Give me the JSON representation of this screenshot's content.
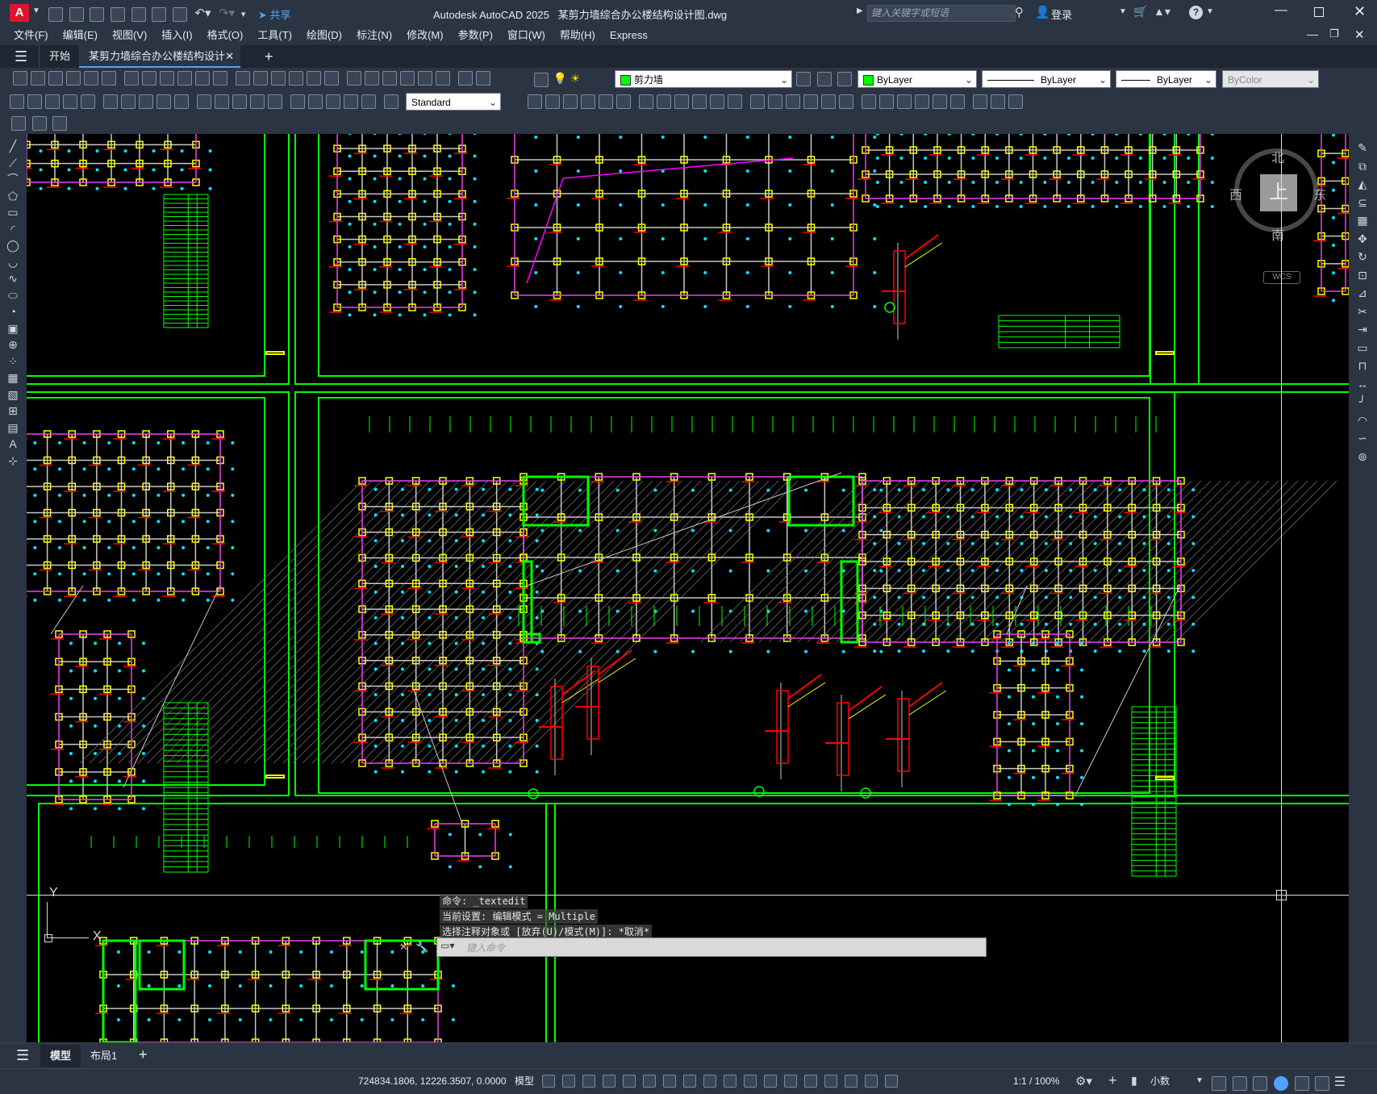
{
  "app": {
    "logo": "A",
    "title": "Autodesk AutoCAD 2025",
    "document": "某剪力墙综合办公楼结构设计图.dwg",
    "share_label": "共享",
    "search_placeholder": "键入关键字或短语",
    "login_label": "登录",
    "help_label": "?"
  },
  "menu": [
    "文件(F)",
    "编辑(E)",
    "视图(V)",
    "插入(I)",
    "格式(O)",
    "工具(T)",
    "绘图(D)",
    "标注(N)",
    "修改(M)",
    "参数(P)",
    "窗口(W)",
    "帮助(H)",
    "Express"
  ],
  "tabs": {
    "start": "开始",
    "active": "某剪力墙综合办公楼结构设计图*",
    "add": "+"
  },
  "toolbar": {
    "layer_name": "剪力墙",
    "layer_color": "#00ff00",
    "color_prop": "ByLayer",
    "linetype_prop": "ByLayer",
    "lineweight_prop": "ByLayer",
    "plotstyle_prop": "ByColor",
    "text_style": "Standard"
  },
  "viewcube": {
    "north": "北",
    "south": "南",
    "east": "东",
    "west": "西",
    "face": "上",
    "wcs": "WCS"
  },
  "ucs": {
    "y": "Y",
    "x": "X"
  },
  "command": {
    "history": [
      "命令: _textedit",
      "当前设置: 编辑模式 = Multiple",
      "选择注释对象或 [放弃(U)/模式(M)]: *取消*"
    ],
    "placeholder": "键入命令"
  },
  "layout_tabs": {
    "model": "模型",
    "layout1": "布局1",
    "add": "+"
  },
  "status": {
    "coords": "724834.1806, 12226.3507, 0.0000",
    "space": "模型",
    "scale": "1:1 / 100%",
    "units": "小数"
  },
  "colors": {
    "wall_green": "#00ff00",
    "beam_gray": "#c8c8c8",
    "column_yellow": "#ffff00",
    "rebar_red": "#ff0000",
    "dim_cyan": "#00e5ff",
    "magenta": "#ff00ff"
  }
}
